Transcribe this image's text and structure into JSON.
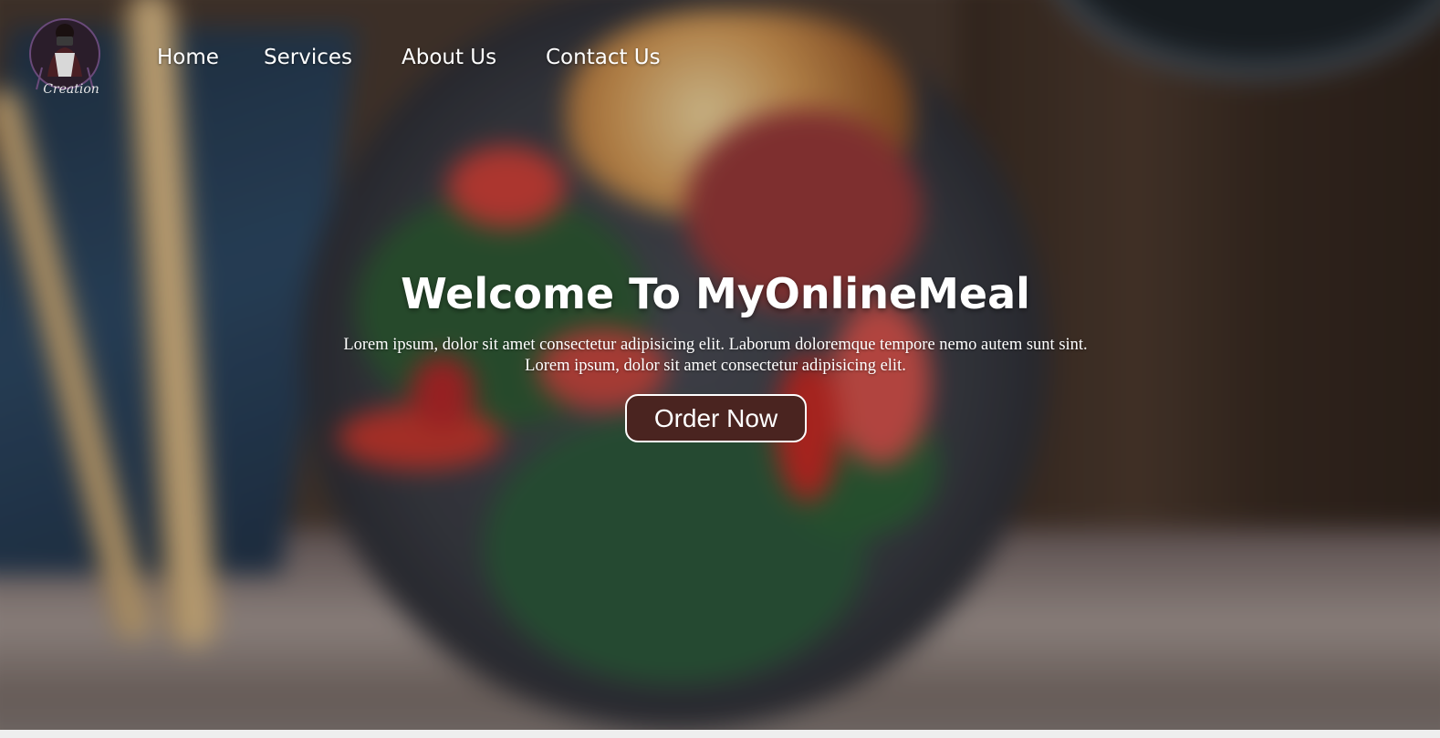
{
  "nav": {
    "logo_text": "Creation",
    "links": [
      {
        "label": "Home"
      },
      {
        "label": "Services"
      },
      {
        "label": "About Us"
      },
      {
        "label": "Contact Us"
      }
    ]
  },
  "hero": {
    "title": "Welcome To MyOnlineMeal",
    "description_line1": "Lorem ipsum, dolor sit amet consectetur adipisicing elit. Laborum doloremque tempore nemo autem sunt sint.",
    "description_line2": "Lorem ipsum, dolor sit amet consectetur adipisicing elit.",
    "cta_label": "Order Now"
  },
  "colors": {
    "cta_background": "#4a2420",
    "cta_border": "#ffffff",
    "text": "#ffffff"
  },
  "icons": {
    "logo": "photographer-logo"
  }
}
